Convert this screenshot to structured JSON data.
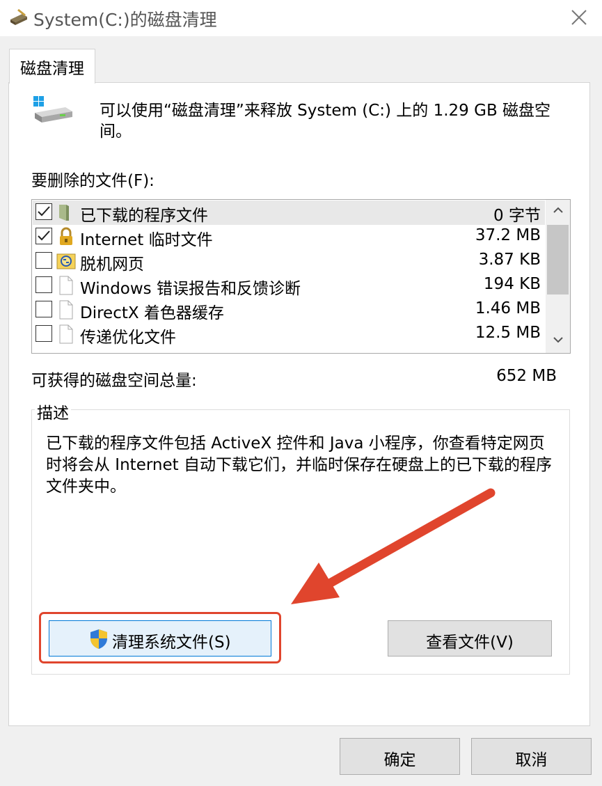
{
  "window": {
    "title": "System(C:)的磁盘清理"
  },
  "tabs": [
    {
      "label": "磁盘清理"
    }
  ],
  "intro": {
    "text": "可以使用“磁盘清理”来释放 System (C:) 上的 1.29 GB 磁盘空间。"
  },
  "files": {
    "label": "要删除的文件(F):",
    "items": [
      {
        "name": "已下载的程序文件",
        "size": "0 字节",
        "checked": true,
        "icon": "folder-icon"
      },
      {
        "name": "Internet 临时文件",
        "size": "37.2 MB",
        "checked": true,
        "icon": "lock-icon"
      },
      {
        "name": "脱机网页",
        "size": "3.87 KB",
        "checked": false,
        "icon": "offline-folder-icon"
      },
      {
        "name": "Windows 错误报告和反馈诊断",
        "size": "194 KB",
        "checked": false,
        "icon": "file-icon"
      },
      {
        "name": "DirectX 着色器缓存",
        "size": "1.46 MB",
        "checked": false,
        "icon": "file-icon"
      },
      {
        "name": "传递优化文件",
        "size": "12.5 MB",
        "checked": false,
        "icon": "file-icon"
      }
    ]
  },
  "total": {
    "label": "可获得的磁盘空间总量:",
    "value": "652 MB"
  },
  "description": {
    "legend": "描述",
    "text": "已下载的程序文件包括 ActiveX 控件和 Java 小程序，你查看特定网页时将会从 Internet 自动下载它们，并临时保存在硬盘上的已下载的程序文件夹中。"
  },
  "buttons": {
    "cleanup_system": "清理系统文件(S)",
    "view_files": "查看文件(V)",
    "ok": "确定",
    "cancel": "取消"
  },
  "colors": {
    "highlight": "#e0452d",
    "accent": "#0078d7"
  }
}
